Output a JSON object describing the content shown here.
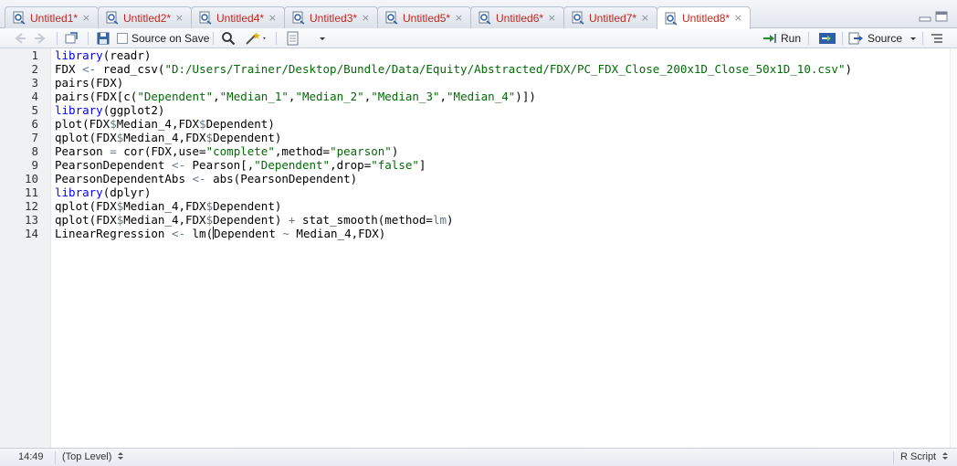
{
  "tabs": [
    {
      "label": "Untitled1*",
      "active": false
    },
    {
      "label": "Untitled2*",
      "active": false
    },
    {
      "label": "Untitled4*",
      "active": false
    },
    {
      "label": "Untitled3*",
      "active": false
    },
    {
      "label": "Untitled5*",
      "active": false
    },
    {
      "label": "Untitled6*",
      "active": false
    },
    {
      "label": "Untitled7*",
      "active": false
    },
    {
      "label": "Untitled8*",
      "active": true
    }
  ],
  "tab_close_glyph": "×",
  "toolbar": {
    "source_on_save_label": "Source on Save",
    "run_label": "Run",
    "source_label": "Source"
  },
  "editor": {
    "line_numbers": [
      "1",
      "2",
      "3",
      "4",
      "5",
      "6",
      "7",
      "8",
      "9",
      "10",
      "11",
      "12",
      "13",
      "14"
    ]
  },
  "status": {
    "cursor_position": "14:49",
    "scope": "(Top Level)",
    "file_type": "R Script"
  },
  "colors": {
    "tab_text": "#c0271f",
    "keyword": "#0000ff",
    "string": "#036a07",
    "run_arrow": "#2d8a34"
  }
}
